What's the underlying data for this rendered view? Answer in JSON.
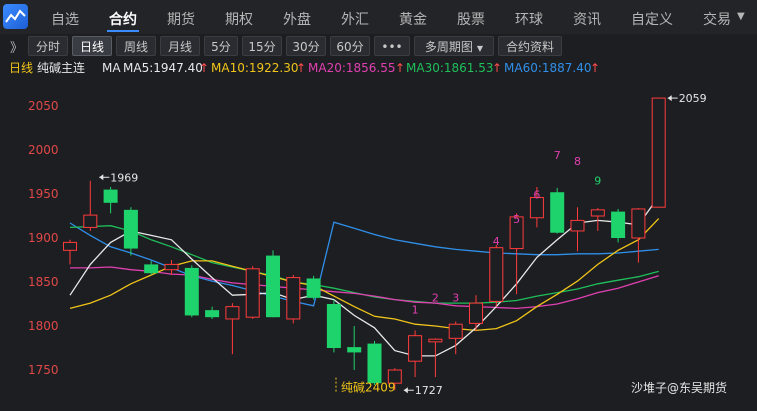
{
  "nav": {
    "items": [
      "自选",
      "合约",
      "期货",
      "期权",
      "外盘",
      "外汇",
      "黄金",
      "股票",
      "环球",
      "资讯",
      "自定义",
      "交易"
    ],
    "active_index": 1
  },
  "toolbar": {
    "buttons": [
      "分时",
      "日线",
      "周线",
      "月线",
      "5分",
      "15分",
      "30分",
      "60分",
      "•••",
      "多周期图",
      "合约资料"
    ],
    "active_index": 1
  },
  "legend": {
    "period": "日线",
    "contract": "纯碱主连",
    "ma_label": "MA",
    "ma5": "MA5:1947.40",
    "ma10": "MA10:1922.30",
    "ma20": "MA20:1856.55",
    "ma30": "MA30:1861.53",
    "ma60": "MA60:1887.40",
    "arrow": "↑"
  },
  "colors": {
    "up": "#ff3b3b",
    "down": "#1fd36c",
    "ma5": "#e8e8e8",
    "ma10": "#f0c419",
    "ma20": "#e040b0",
    "ma30": "#1fbf5a",
    "ma60": "#2f8fe8",
    "seq": "#e040b0",
    "seq9": "#1fd36c",
    "watermark_contract": "#f0c419"
  },
  "watermark": "沙堆子@东吴期货",
  "chart_data": {
    "type": "candlestick",
    "ylim": [
      1720,
      2075
    ],
    "yticks": [
      1750,
      1800,
      1850,
      1900,
      1950,
      2000,
      2050
    ],
    "candles": [
      {
        "o": 1886,
        "h": 1898,
        "l": 1870,
        "c": 1895
      },
      {
        "o": 1912,
        "h": 1965,
        "l": 1908,
        "c": 1926
      },
      {
        "o": 1955,
        "h": 1958,
        "l": 1928,
        "c": 1940
      },
      {
        "o": 1932,
        "h": 1935,
        "l": 1880,
        "c": 1888
      },
      {
        "o": 1870,
        "h": 1874,
        "l": 1858,
        "c": 1860
      },
      {
        "o": 1864,
        "h": 1875,
        "l": 1858,
        "c": 1870
      },
      {
        "o": 1866,
        "h": 1869,
        "l": 1810,
        "c": 1812
      },
      {
        "o": 1818,
        "h": 1822,
        "l": 1808,
        "c": 1810
      },
      {
        "o": 1808,
        "h": 1826,
        "l": 1768,
        "c": 1822
      },
      {
        "o": 1810,
        "h": 1868,
        "l": 1808,
        "c": 1865
      },
      {
        "o": 1880,
        "h": 1886,
        "l": 1810,
        "c": 1810
      },
      {
        "o": 1808,
        "h": 1858,
        "l": 1803,
        "c": 1855
      },
      {
        "o": 1854,
        "h": 1857,
        "l": 1830,
        "c": 1832
      },
      {
        "o": 1825,
        "h": 1830,
        "l": 1770,
        "c": 1775
      },
      {
        "o": 1776,
        "h": 1800,
        "l": 1750,
        "c": 1770
      },
      {
        "o": 1780,
        "h": 1783,
        "l": 1733,
        "c": 1735
      },
      {
        "o": 1735,
        "h": 1752,
        "l": 1727,
        "c": 1750
      },
      {
        "o": 1760,
        "h": 1795,
        "l": 1742,
        "c": 1789
      },
      {
        "o": 1782,
        "h": 1786,
        "l": 1742,
        "c": 1785
      },
      {
        "o": 1786,
        "h": 1805,
        "l": 1768,
        "c": 1802
      },
      {
        "o": 1803,
        "h": 1835,
        "l": 1794,
        "c": 1826
      },
      {
        "o": 1828,
        "h": 1892,
        "l": 1822,
        "c": 1889
      },
      {
        "o": 1888,
        "h": 1928,
        "l": 1836,
        "c": 1924
      },
      {
        "o": 1923,
        "h": 1958,
        "l": 1912,
        "c": 1946
      },
      {
        "o": 1952,
        "h": 1957,
        "l": 1905,
        "c": 1906
      },
      {
        "o": 1908,
        "h": 1935,
        "l": 1885,
        "c": 1920
      },
      {
        "o": 1925,
        "h": 1934,
        "l": 1908,
        "c": 1932
      },
      {
        "o": 1930,
        "h": 1933,
        "l": 1895,
        "c": 1900
      },
      {
        "o": 1900,
        "h": 1934,
        "l": 1872,
        "c": 1933
      },
      {
        "o": 1935,
        "h": 2059,
        "l": 1935,
        "c": 2059
      }
    ],
    "ma5": [
      1835,
      1870,
      1895,
      1908,
      1903,
      1898,
      1876,
      1855,
      1835,
      1836,
      1838,
      1830,
      1835,
      1830,
      1812,
      1798,
      1772,
      1766,
      1766,
      1778,
      1798,
      1822,
      1848,
      1878,
      1898,
      1917,
      1920,
      1918,
      1915,
      1947
    ],
    "ma10": [
      1820,
      1826,
      1835,
      1848,
      1858,
      1868,
      1874,
      1874,
      1868,
      1862,
      1856,
      1850,
      1846,
      1834,
      1822,
      1811,
      1808,
      1802,
      1800,
      1797,
      1795,
      1797,
      1806,
      1822,
      1836,
      1851,
      1870,
      1886,
      1898,
      1922
    ],
    "ma20": [
      1866,
      1866,
      1867,
      1864,
      1862,
      1859,
      1858,
      1853,
      1849,
      1847,
      1845,
      1843,
      1841,
      1839,
      1837,
      1834,
      1830,
      1827,
      1826,
      1823,
      1822,
      1821,
      1820,
      1822,
      1825,
      1831,
      1838,
      1843,
      1850,
      1857
    ],
    "ma30": [
      1912,
      1913,
      1914,
      1908,
      1898,
      1890,
      1881,
      1872,
      1867,
      1862,
      1857,
      1850,
      1847,
      1843,
      1838,
      1833,
      1830,
      1828,
      1826,
      1826,
      1826,
      1827,
      1829,
      1834,
      1838,
      1842,
      1848,
      1852,
      1856,
      1862
    ],
    "ma60": [
      1917,
      1903,
      1890,
      1883,
      1875,
      1866,
      1857,
      1851,
      1846,
      1840,
      1834,
      1828,
      1823,
      1918,
      1911,
      1904,
      1898,
      1894,
      1890,
      1887,
      1885,
      1883,
      1882,
      1881,
      1881,
      1882,
      1882,
      1883,
      1885,
      1887
    ],
    "annotations": [
      {
        "i": 1,
        "price": 1969,
        "text": "1969"
      },
      {
        "i": 29,
        "price": 2059,
        "text": "2059"
      },
      {
        "i": 16,
        "price": 1727,
        "text": "1727"
      }
    ],
    "seq_labels": [
      {
        "i": 17,
        "price": 1814,
        "text": "1"
      },
      {
        "i": 18,
        "price": 1828,
        "text": "2"
      },
      {
        "i": 19,
        "price": 1828,
        "text": "3"
      },
      {
        "i": 21,
        "price": 1892,
        "text": "4"
      },
      {
        "i": 22,
        "price": 1917,
        "text": "5"
      },
      {
        "i": 23,
        "price": 1945,
        "text": "6"
      },
      {
        "i": 24,
        "price": 1990,
        "text": "7"
      },
      {
        "i": 25,
        "price": 1983,
        "text": "8"
      },
      {
        "i": 26,
        "price": 1961,
        "text": "9"
      }
    ],
    "contract_mark": "纯碱2409"
  }
}
